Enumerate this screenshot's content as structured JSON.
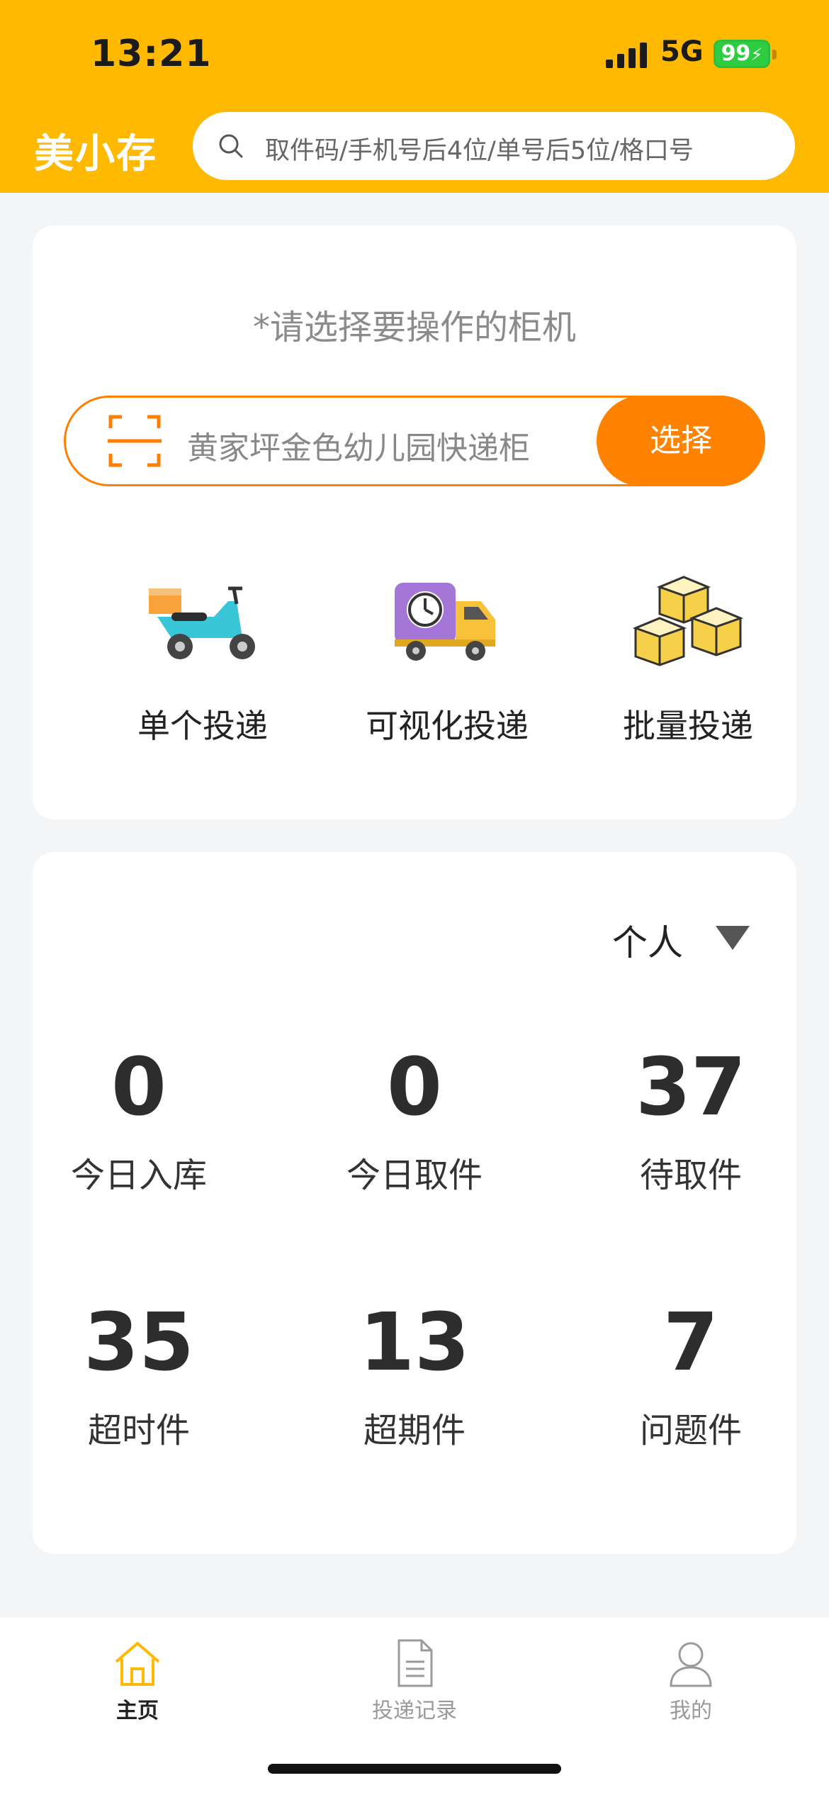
{
  "status_bar": {
    "time": "13:21",
    "network": "5G",
    "battery": "99"
  },
  "header": {
    "brand": "美小存",
    "search_placeholder": "取件码/手机号后4位/单号后5位/格口号"
  },
  "cabinet": {
    "hint": "*请选择要操作的柜机",
    "name": "黄家坪金色幼儿园快递柜",
    "select_label": "选择"
  },
  "actions": [
    {
      "label": "单个投递",
      "icon": "scooter-icon"
    },
    {
      "label": "可视化投递",
      "icon": "truck-clock-icon"
    },
    {
      "label": "批量投递",
      "icon": "boxes-icon"
    }
  ],
  "stats": {
    "filter_value": "个人",
    "items": [
      {
        "value": "0",
        "label": "今日入库"
      },
      {
        "value": "0",
        "label": "今日取件"
      },
      {
        "value": "37",
        "label": "待取件"
      },
      {
        "value": "35",
        "label": "超时件"
      },
      {
        "value": "13",
        "label": "超期件"
      },
      {
        "value": "7",
        "label": "问题件"
      }
    ]
  },
  "bottom_nav": {
    "items": [
      {
        "label": "主页",
        "active": true,
        "icon": "home-icon"
      },
      {
        "label": "投递记录",
        "active": false,
        "icon": "document-icon"
      },
      {
        "label": "我的",
        "active": false,
        "icon": "user-icon"
      }
    ]
  },
  "colors": {
    "header_bg": "#FFB900",
    "accent_orange": "#FF8200",
    "battery_green": "#2ECC40"
  }
}
